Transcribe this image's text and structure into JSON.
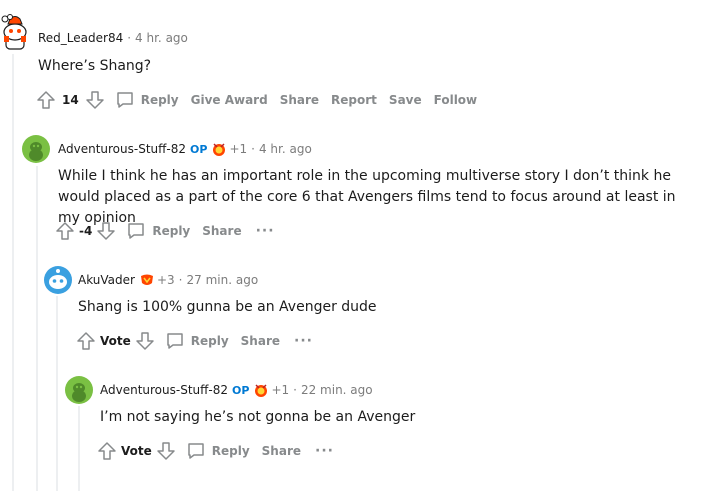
{
  "comments": [
    {
      "username": "Red_Leader84",
      "time": "4 hr. ago",
      "body": "Where’s Shang?",
      "score": "14",
      "actions": {
        "reply": "Reply",
        "award": "Give Award",
        "share": "Share",
        "report": "Report",
        "save": "Save",
        "follow": "Follow"
      }
    },
    {
      "username": "Adventurous-Stuff-82",
      "op": "OP",
      "flair_count": "+1",
      "time": "4 hr. ago",
      "body": "While I think he has an important role in the upcoming multiverse story I don’t think he would placed as a part of the core 6 that Avengers films tend to focus around at least in my opinion",
      "score": "-4",
      "actions": {
        "reply": "Reply",
        "share": "Share",
        "more": "···"
      }
    },
    {
      "username": "AkuVader",
      "flair_count": "+3",
      "time": "27 min. ago",
      "body": "Shang is 100% gunna be an Avenger dude",
      "score": "Vote",
      "actions": {
        "reply": "Reply",
        "share": "Share",
        "more": "···"
      }
    },
    {
      "username": "Adventurous-Stuff-82",
      "op": "OP",
      "flair_count": "+1",
      "time": "22 min. ago",
      "body": "I’m not saying he’s not gonna be an Avenger",
      "score": "Vote",
      "actions": {
        "reply": "Reply",
        "share": "Share",
        "more": "···"
      }
    }
  ],
  "separator": "·",
  "colors": {
    "op": "#0079d3",
    "meta": "#7c7c7c",
    "action": "#878a8c",
    "avatar_green": "#7ac043",
    "snoo_blue": "#3aa0e0",
    "snoo_red": "#ff4500",
    "thread": "#edeff1"
  }
}
